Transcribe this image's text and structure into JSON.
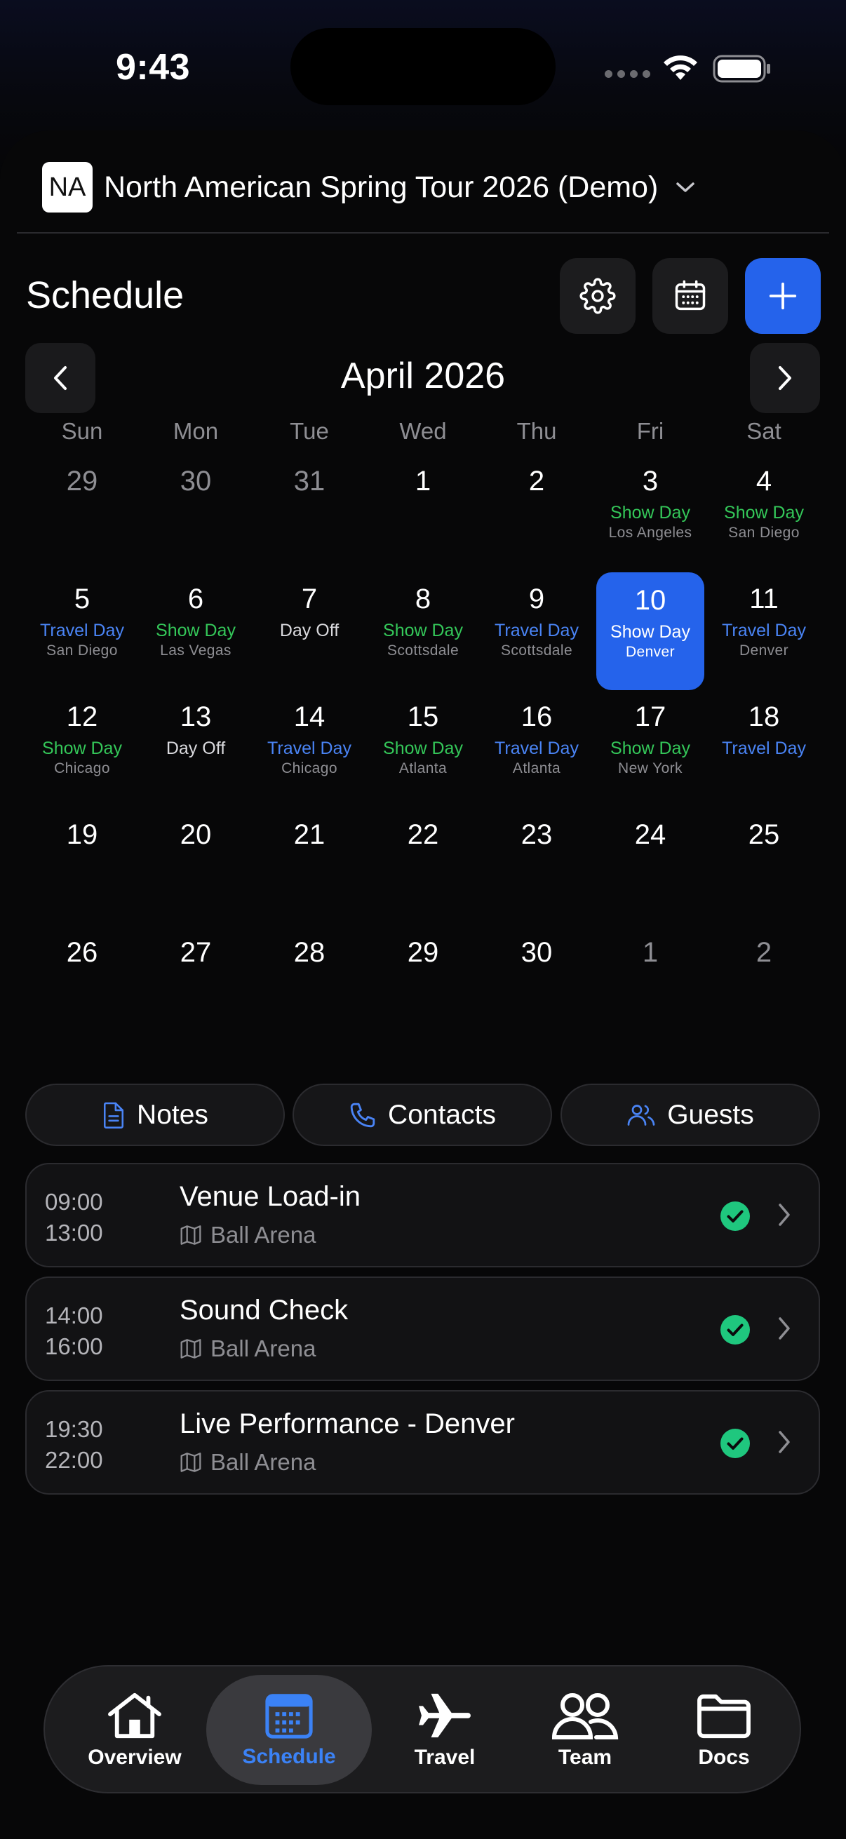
{
  "status_bar": {
    "time": "9:43"
  },
  "tour": {
    "logo": "NA",
    "title": "North American Spring Tour 2026 (Demo)"
  },
  "schedule": {
    "title": "Schedule"
  },
  "toolbar": {
    "icons": [
      "gear-icon",
      "calendar-icon",
      "plus-icon"
    ]
  },
  "calendar": {
    "month": "April 2026",
    "weekdays": [
      "Sun",
      "Mon",
      "Tue",
      "Wed",
      "Thu",
      "Fri",
      "Sat"
    ],
    "selected_day": "10",
    "weeks": [
      [
        {
          "day": "29",
          "other": true,
          "type": "",
          "city": ""
        },
        {
          "day": "30",
          "other": true,
          "type": "",
          "city": ""
        },
        {
          "day": "31",
          "other": true,
          "type": "",
          "city": ""
        },
        {
          "day": "1",
          "type": "",
          "city": ""
        },
        {
          "day": "2",
          "type": "",
          "city": ""
        },
        {
          "day": "3",
          "type": "Show Day",
          "kind": "show",
          "city": "Los Angeles"
        },
        {
          "day": "4",
          "type": "Show Day",
          "kind": "show",
          "city": "San Diego"
        }
      ],
      [
        {
          "day": "5",
          "type": "Travel Day",
          "kind": "travel",
          "city": "San Diego"
        },
        {
          "day": "6",
          "type": "Show Day",
          "kind": "show",
          "city": "Las Vegas"
        },
        {
          "day": "7",
          "type": "Day Off",
          "kind": "off",
          "city": ""
        },
        {
          "day": "8",
          "type": "Show Day",
          "kind": "show",
          "city": "Scottsdale"
        },
        {
          "day": "9",
          "type": "Travel Day",
          "kind": "travel",
          "city": "Scottsdale"
        },
        {
          "day": "10",
          "type": "Show Day",
          "kind": "show",
          "city": "Denver",
          "selected": true
        },
        {
          "day": "11",
          "type": "Travel Day",
          "kind": "travel",
          "city": "Denver"
        }
      ],
      [
        {
          "day": "12",
          "type": "Show Day",
          "kind": "show",
          "city": "Chicago"
        },
        {
          "day": "13",
          "type": "Day Off",
          "kind": "off",
          "city": ""
        },
        {
          "day": "14",
          "type": "Travel Day",
          "kind": "travel",
          "city": "Chicago"
        },
        {
          "day": "15",
          "type": "Show Day",
          "kind": "show",
          "city": "Atlanta"
        },
        {
          "day": "16",
          "type": "Travel Day",
          "kind": "travel",
          "city": "Atlanta"
        },
        {
          "day": "17",
          "type": "Show Day",
          "kind": "show",
          "city": "New York"
        },
        {
          "day": "18",
          "type": "Travel Day",
          "kind": "travel",
          "city": ""
        }
      ],
      [
        {
          "day": "19",
          "type": "",
          "city": ""
        },
        {
          "day": "20",
          "type": "",
          "city": ""
        },
        {
          "day": "21",
          "type": "",
          "city": ""
        },
        {
          "day": "22",
          "type": "",
          "city": ""
        },
        {
          "day": "23",
          "type": "",
          "city": ""
        },
        {
          "day": "24",
          "type": "",
          "city": ""
        },
        {
          "day": "25",
          "type": "",
          "city": ""
        }
      ],
      [
        {
          "day": "26",
          "type": "",
          "city": ""
        },
        {
          "day": "27",
          "type": "",
          "city": ""
        },
        {
          "day": "28",
          "type": "",
          "city": ""
        },
        {
          "day": "29",
          "type": "",
          "city": ""
        },
        {
          "day": "30",
          "type": "",
          "city": ""
        },
        {
          "day": "1",
          "other": true,
          "type": "",
          "city": ""
        },
        {
          "day": "2",
          "other": true,
          "type": "",
          "city": ""
        }
      ]
    ]
  },
  "segments": [
    {
      "label": "Notes",
      "icon": "document-icon"
    },
    {
      "label": "Contacts",
      "icon": "phone-icon"
    },
    {
      "label": "Guests",
      "icon": "guests-icon"
    }
  ],
  "events": [
    {
      "start": "09:00",
      "end": "13:00",
      "title": "Venue Load-in",
      "venue": "Ball Arena",
      "status": "confirmed"
    },
    {
      "start": "14:00",
      "end": "16:00",
      "title": "Sound Check",
      "venue": "Ball Arena",
      "status": "confirmed"
    },
    {
      "start": "19:30",
      "end": "22:00",
      "title": "Live Performance - Denver",
      "venue": "Ball Arena",
      "status": "confirmed"
    }
  ],
  "tabbar": {
    "active": "Schedule",
    "tabs": [
      {
        "label": "Overview",
        "icon": "house-icon"
      },
      {
        "label": "Schedule",
        "icon": "calendar-icon"
      },
      {
        "label": "Travel",
        "icon": "airplane-icon"
      },
      {
        "label": "Team",
        "icon": "people-icon"
      },
      {
        "label": "Docs",
        "icon": "folder-icon"
      }
    ]
  },
  "colors": {
    "accent": "#2563eb",
    "show_day": "#34c759",
    "travel_day": "#4a84f5",
    "confirmed": "#1fc77e"
  }
}
